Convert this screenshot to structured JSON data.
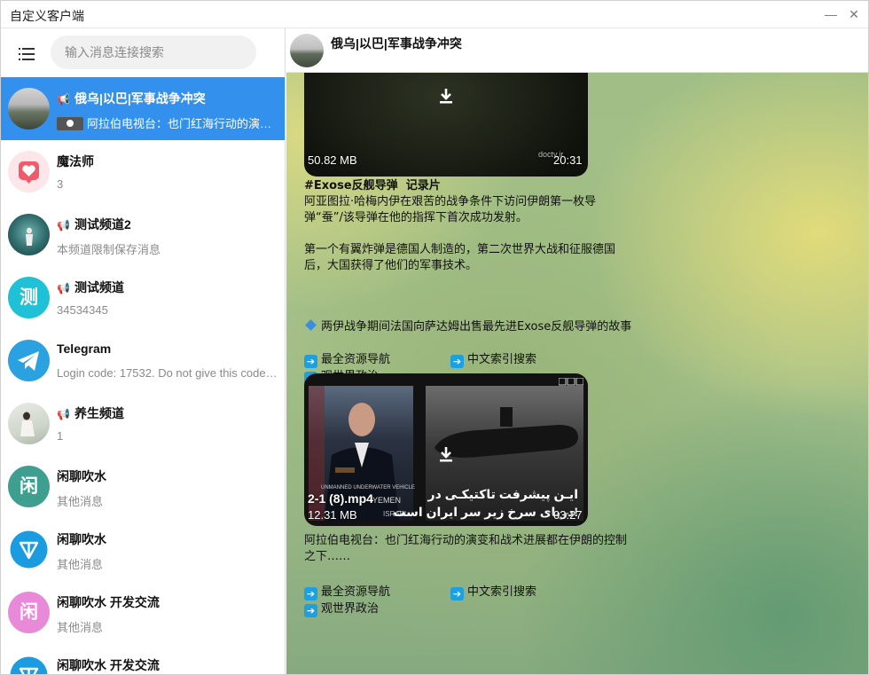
{
  "window": {
    "title": "自定义客户端",
    "minimize": "—",
    "close": "✕"
  },
  "search": {
    "placeholder": "输入消息连接搜索"
  },
  "chats": [
    {
      "name": "俄乌|以巴|军事战争冲突",
      "preview": "阿拉伯电视台：也门红海行动的演变和战术进展都在伊朗的控制之下……",
      "channel": true,
      "active": true
    },
    {
      "name": "魔法师",
      "preview": "3",
      "channel": false,
      "active": false
    },
    {
      "name": "测试频道2",
      "preview": "本频道限制保存消息",
      "channel": true,
      "active": false
    },
    {
      "name": "测试频道",
      "preview": "34534345",
      "channel": true,
      "active": false,
      "letter": "测"
    },
    {
      "name": "Telegram",
      "preview": "Login code: 17532. Do not give this code to anyone",
      "channel": false,
      "active": false
    },
    {
      "name": "养生频道",
      "preview": "1",
      "channel": true,
      "active": false
    },
    {
      "name": "闲聊吹水",
      "preview": "其他消息",
      "channel": false,
      "active": false,
      "letter": "闲"
    },
    {
      "name": "闲聊吹水",
      "preview": "其他消息",
      "channel": false,
      "active": false
    },
    {
      "name": "闲聊吹水 开发交流",
      "preview": "其他消息",
      "channel": false,
      "active": false,
      "letter": "闲"
    },
    {
      "name": "闲聊吹水 开发交流",
      "preview": "",
      "channel": false,
      "active": false
    }
  ],
  "header": {
    "title": "俄乌|以巴|军事战争冲突"
  },
  "message1": {
    "size": "50.82 MB",
    "duration": "20:31",
    "watermark": "doctv.ir",
    "hashtag_line": "#Exose反舰导弹  记录片",
    "body": "阿亚图拉·哈梅内伊在艰苦的战争条件下访问伊朗第一枚导\n弹“蚕”/该导弹在他的指挥下首次成功发射。\n\n第一个有翼炸弹是德国人制造的，第二次世界大战和征服德国\n后，大国获得了他们的军事技术。",
    "bullet": "两伊战争期间法国向萨达姆出售最先进Exose反舰导弹的故事",
    "nav": [
      "最全资源导航",
      "中文索引搜索",
      "观世界政治"
    ]
  },
  "message2": {
    "filename": "2-1 (8).mp4",
    "size": "12.31 MB",
    "duration": "03:27",
    "overlay_text_1": "ایـن پیشرفت تاکتیکـی در",
    "overlay_text_2": "دریای سرخ زیر سر ایران است!",
    "overlay_en_1": "UNMANNED UNDERWATER VEHICLE",
    "overlay_en_2": "YEMEN",
    "overlay_en_3": "ISRAEL",
    "caption": "阿拉伯电视台：也门红海行动的演变和战术进展都在伊朗的控制\n之下……",
    "nav": [
      "最全资源导航",
      "中文索引搜索",
      "观世界政治"
    ]
  },
  "colors": {
    "accent": "#3390ec",
    "telegram": "#2aa1e0",
    "test_channel": "#1ec1d6",
    "idle_chat_green": "#3e9e8f",
    "idle_chat_pink": "#e88ad8"
  }
}
